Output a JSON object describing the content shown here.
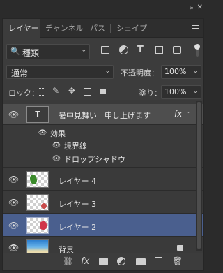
{
  "window": {
    "collapse_glyph": "»",
    "close_glyph": "✕"
  },
  "tabs": [
    {
      "label": "レイヤー",
      "active": true
    },
    {
      "label": "チャンネル",
      "active": false
    },
    {
      "label": "パス",
      "active": false
    },
    {
      "label": "シェイプ",
      "active": false
    }
  ],
  "filter": {
    "kind_label": "種類",
    "icon_glyph": "🔍",
    "icons": [
      "image-filter-icon",
      "adjustment-filter-icon",
      "type-filter-icon",
      "shape-filter-icon",
      "smart-object-filter-icon"
    ],
    "type_glyph": "T"
  },
  "blend": {
    "mode": "通常",
    "opacity_label": "不透明度：",
    "opacity_value": "100%"
  },
  "lock": {
    "label": "ロック：",
    "fill_label": "塗り：",
    "fill_value": "100%"
  },
  "layers": {
    "text_layer": {
      "name": "暑中見舞い　申し上げます",
      "fx": "fx",
      "thumb_glyph": "T"
    },
    "effects_label": "効果",
    "effects": [
      "境界線",
      "ドロップシャドウ"
    ],
    "rows": [
      {
        "name": "レイヤー 4",
        "selected": false
      },
      {
        "name": "レイヤー 3",
        "selected": false
      },
      {
        "name": "レイヤー 2",
        "selected": true
      },
      {
        "name": "背景",
        "selected": false
      }
    ]
  },
  "colors": {
    "selected_row": "#4a5f8e",
    "text_layer_row": "#4e4e4e"
  },
  "bottom_icons": [
    "link-layers-icon",
    "fx-icon",
    "add-mask-icon",
    "adjustment-layer-icon",
    "new-group-icon",
    "new-layer-icon",
    "delete-layer-icon"
  ],
  "bottom_fx": "fx"
}
